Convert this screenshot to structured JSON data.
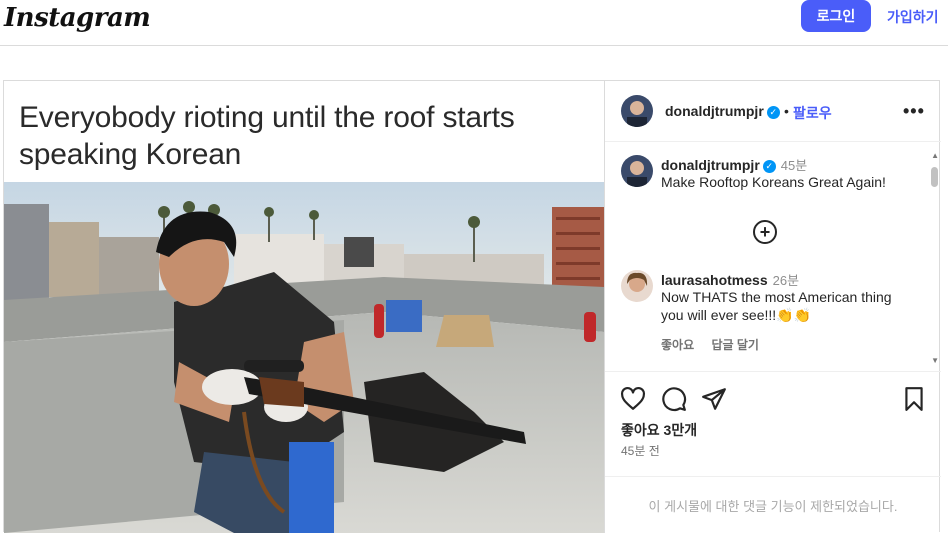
{
  "header": {
    "logo": "Instagram",
    "login_label": "로그인",
    "signup_label": "가입하기"
  },
  "post": {
    "caption_image_text": "Everyobody rioting until the roof starts speaking Korean",
    "author": {
      "username": "donaldjtrumpjr",
      "follow_label": "팔로우",
      "separator": "•"
    },
    "comments": [
      {
        "username": "donaldjtrumpjr",
        "time": "45분",
        "text": "Make Rooftop Koreans Great Again!"
      },
      {
        "username": "laurasahotmess",
        "time": "26분",
        "text": "Now THATS the most American thing you will ever see!!!👏👏",
        "actions": [
          "좋아요",
          "답글 달기"
        ]
      }
    ],
    "likes_label": "좋아요 3만개",
    "posted_label": "45분 전",
    "restricted_notice": "이 게시물에 대한 댓글 기능이 제한되었습니다."
  },
  "colors": {
    "accent": "#4a5df9",
    "verified": "#0095f6",
    "border": "#dbdbdb"
  }
}
